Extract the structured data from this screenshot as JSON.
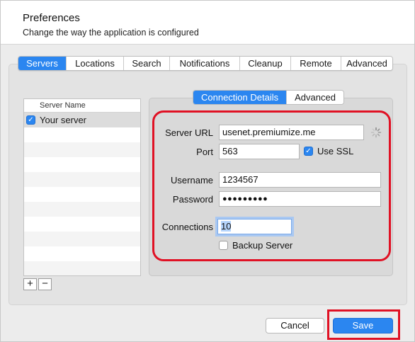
{
  "header": {
    "title": "Preferences",
    "subtitle": "Change the way the application is configured"
  },
  "tabs": [
    {
      "label": "Servers",
      "active": true
    },
    {
      "label": "Locations",
      "active": false
    },
    {
      "label": "Search",
      "active": false
    },
    {
      "label": "Notifications",
      "active": false
    },
    {
      "label": "Cleanup",
      "active": false
    },
    {
      "label": "Remote",
      "active": false
    },
    {
      "label": "Advanced",
      "active": false
    }
  ],
  "server_list": {
    "column_header": "Server Name",
    "rows": [
      {
        "name": "Your server",
        "checked": true
      }
    ],
    "add_label": "+",
    "remove_label": "−"
  },
  "details_tabs": [
    {
      "label": "Connection Details",
      "active": true
    },
    {
      "label": "Advanced",
      "active": false
    }
  ],
  "form": {
    "server_url_label": "Server URL",
    "server_url_value": "usenet.premiumize.me",
    "port_label": "Port",
    "port_value": "563",
    "use_ssl_label": "Use SSL",
    "use_ssl_checked": true,
    "username_label": "Username",
    "username_value": "1234567",
    "password_label": "Password",
    "password_value": "●●●●●●●●●",
    "connections_label": "Connections",
    "connections_value": "10",
    "backup_label": "Backup Server",
    "backup_checked": false
  },
  "footer": {
    "cancel_label": "Cancel",
    "save_label": "Save"
  },
  "colors": {
    "accent": "#2b86f0",
    "highlight_red": "#e01124"
  }
}
